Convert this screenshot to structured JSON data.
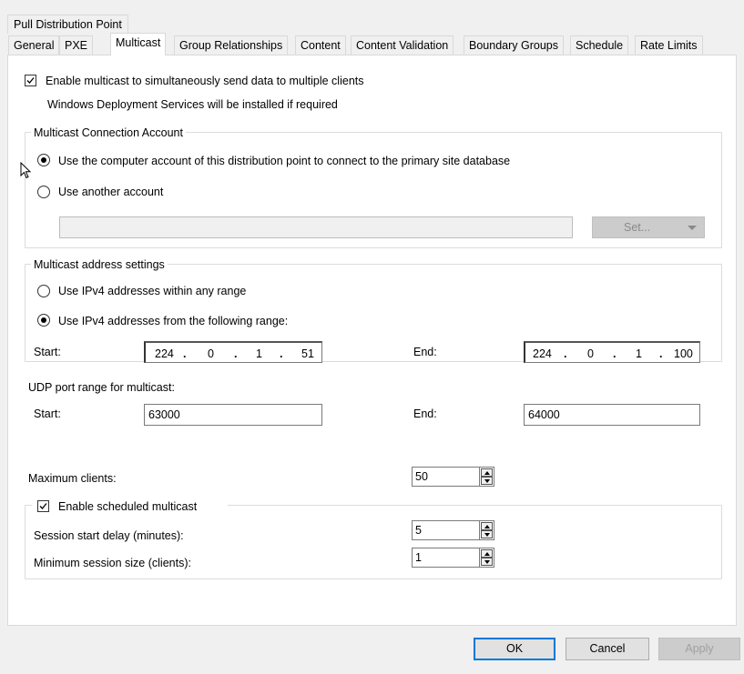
{
  "window_title": "Pull Distribution Point",
  "tabs": [
    "General",
    "PXE",
    "Multicast",
    "Group Relationships",
    "Content",
    "Content Validation",
    "Boundary Groups",
    "Schedule",
    "Rate Limits"
  ],
  "active_tab": "Multicast",
  "multicast": {
    "enable_label": "Enable multicast to simultaneously send data to multiple clients",
    "enable_checked": true,
    "wds_note": "Windows Deployment Services will be installed if required"
  },
  "connection": {
    "title": "Multicast Connection Account",
    "option_computer": "Use the computer account of this distribution point to connect to the primary site database",
    "option_other": "Use another account",
    "selected": "computer",
    "account_value": "",
    "set_button": "Set..."
  },
  "address": {
    "title": "Multicast address settings",
    "option_any": "Use IPv4 addresses within any range",
    "option_range": "Use IPv4 addresses from the following range:",
    "selected": "range",
    "start_label": "Start:",
    "end_label": "End:",
    "start_ip": [
      "224",
      "0",
      "1",
      "51"
    ],
    "end_ip": [
      "224",
      "0",
      "1",
      "100"
    ]
  },
  "udp": {
    "title": "UDP port range for multicast:",
    "start_label": "Start:",
    "end_label": "End:",
    "start_value": "63000",
    "end_value": "64000"
  },
  "max_clients": {
    "label": "Maximum clients:",
    "value": "50"
  },
  "scheduled": {
    "enable_label": "Enable scheduled multicast",
    "enable_checked": true,
    "delay_label": "Session start delay (minutes):",
    "delay_value": "5",
    "min_size_label": "Minimum session size (clients):",
    "min_size_value": "1"
  },
  "buttons": {
    "ok": "OK",
    "cancel": "Cancel",
    "apply": "Apply"
  }
}
